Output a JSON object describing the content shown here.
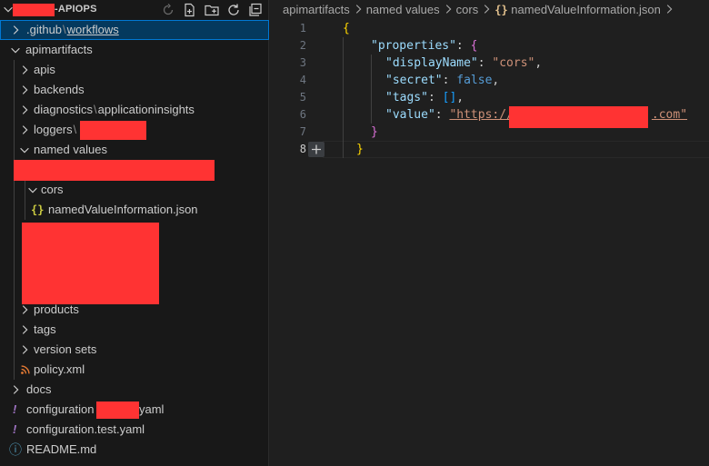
{
  "explorer": {
    "title_suffix": "-APIOPS",
    "rows": [
      {
        "id": "github",
        "part1": ".github",
        "part2": "workflows"
      },
      {
        "id": "apimartifacts",
        "label": "apimartifacts"
      },
      {
        "id": "apis",
        "label": "apis"
      },
      {
        "id": "backends",
        "label": "backends"
      },
      {
        "id": "diagnostics",
        "part1": "diagnostics",
        "part2": "applicationinsights"
      },
      {
        "id": "loggers",
        "part1": "loggers"
      },
      {
        "id": "named-values",
        "label": "named values"
      },
      {
        "id": "cors",
        "label": "cors"
      },
      {
        "id": "named-value-json",
        "label": "namedValueInformation.json"
      },
      {
        "id": "products",
        "label": "products"
      },
      {
        "id": "tags",
        "label": "tags"
      },
      {
        "id": "version-sets",
        "label": "version sets"
      },
      {
        "id": "policy",
        "label": "policy.xml"
      },
      {
        "id": "docs",
        "label": "docs"
      },
      {
        "id": "config-prod",
        "part1": "configuration",
        "part2": "yaml"
      },
      {
        "id": "config-test",
        "label": "configuration.test.yaml"
      },
      {
        "id": "readme",
        "label": "README.md"
      }
    ],
    "path_separator": "\\"
  },
  "icons": {
    "json_file": "{}",
    "yaml_file": "!",
    "readme_file": "ⓘ"
  },
  "editor": {
    "breadcrumb": [
      "apimartifacts",
      "named values",
      "cors",
      "namedValueInformation.json"
    ],
    "line_numbers": [
      "1",
      "2",
      "3",
      "4",
      "5",
      "6",
      "7",
      "8"
    ],
    "code": {
      "open_brace": "{",
      "properties_key": "\"properties\"",
      "displayName_key": "\"displayName\"",
      "displayName_val": "\"cors\"",
      "secret_key": "\"secret\"",
      "secret_val": "false",
      "tags_key": "\"tags\"",
      "tags_val": "[]",
      "value_key": "\"value\"",
      "value_prefix": "\"https://",
      "value_suffix": ".com\"",
      "close_inner": "}",
      "close_outer": "}",
      "colon": ": ",
      "comma": ","
    }
  },
  "colors": {
    "selection": "#04395e",
    "focus_border": "#0078d4",
    "redaction": "#ff3333",
    "yaml_icon": "#a074c4",
    "xml_icon": "#e37933",
    "json_icon": "#cbcb41"
  }
}
